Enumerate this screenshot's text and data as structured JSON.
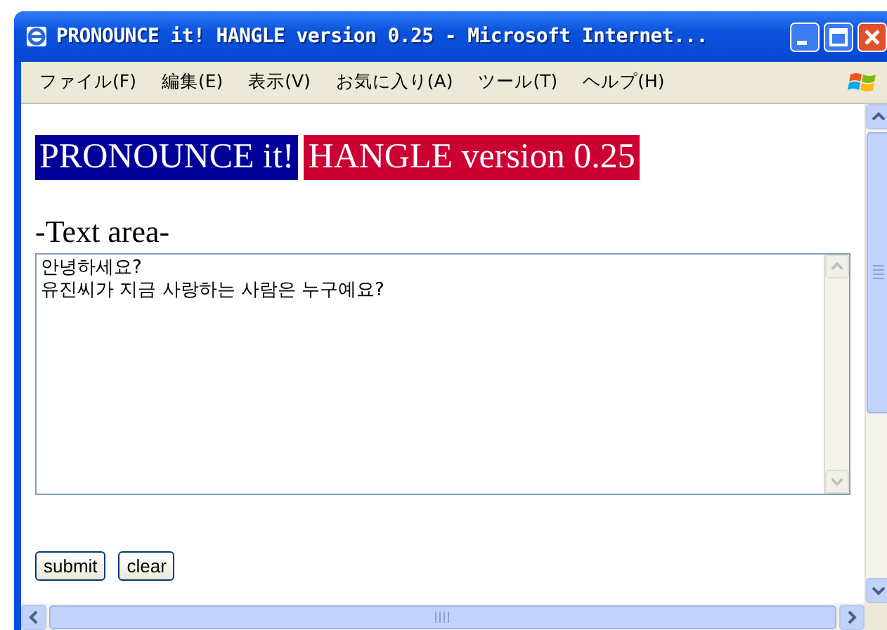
{
  "window": {
    "title": "PRONOUNCE it! HANGLE version 0.25 - Microsoft Internet..."
  },
  "menu": [
    "ファイル(F)",
    "編集(E)",
    "表示(V)",
    "お気に入り(A)",
    "ツール(T)",
    "ヘルプ(H)"
  ],
  "heading": [
    {
      "text": "PRONOUNCE it!",
      "color": "#000099"
    },
    {
      "text": "HANGLE version 0.25",
      "color": "#cc0033"
    }
  ],
  "section_label": "-Text area-",
  "text_area": {
    "value": "안녕하세요?\n유진씨가 지금 사랑하는 사람은 누구예요?"
  },
  "buttons": [
    "submit",
    "clear"
  ]
}
